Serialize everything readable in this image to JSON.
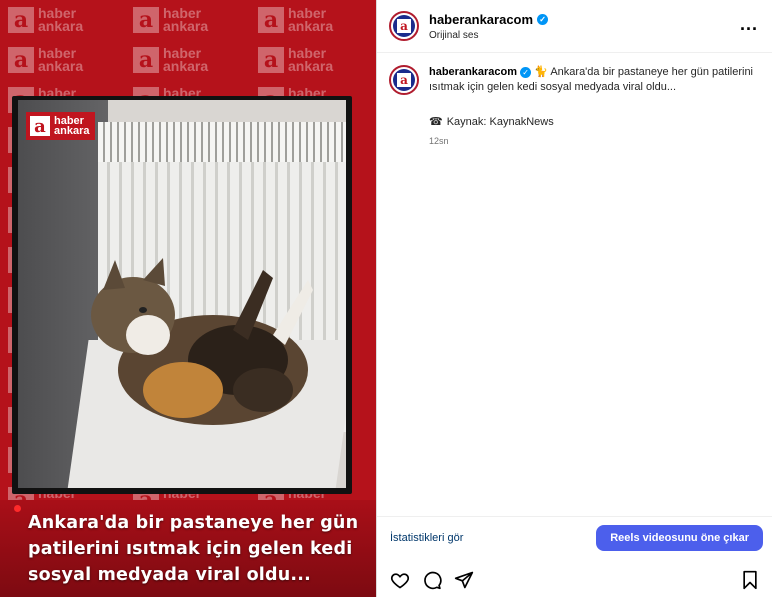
{
  "media": {
    "watermark_text_1": "haber",
    "watermark_text_2": "ankara",
    "logo_letter": "a",
    "logo_line1": "haber",
    "logo_line2": "ankara",
    "caption": "Ankara'da bir pastaneye her gün patilerini ısıtmak için gelen kedi sosyal medyada viral oldu..."
  },
  "header": {
    "username": "haberankaracom",
    "audio": "Orijinal ses",
    "more_label": "..."
  },
  "post": {
    "username": "haberankaracom",
    "emoji": "🐈",
    "text": "Ankara'da bir pastaneye her gün patilerini ısıtmak için gelen kedi sosyal medyada viral oldu...",
    "source_icon": "☎",
    "source": "Kaynak: KaynakNews",
    "time": "12sn"
  },
  "actions": {
    "stats_label": "İstatistikleri gör",
    "promote_label": "Reels videosunu öne çıkar"
  },
  "icons": [
    "heart-icon",
    "comment-icon",
    "share-icon",
    "bookmark-icon"
  ],
  "colors": {
    "brand_red": "#b5121b",
    "accent_blue": "#4c5fec",
    "verified": "#0095f6"
  }
}
